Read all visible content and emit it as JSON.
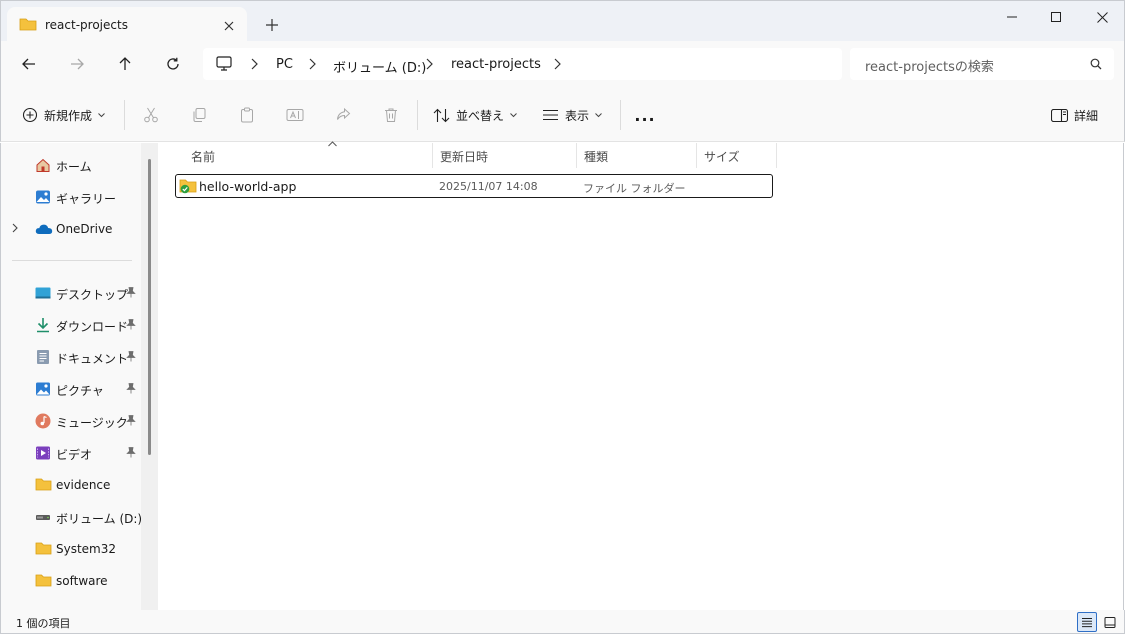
{
  "tab": {
    "title": "react-projects",
    "icon": "folder-icon"
  },
  "window_controls": [
    "minimize-icon",
    "maximize-icon",
    "close-icon"
  ],
  "address": {
    "root_icon": "pc-monitor-icon",
    "breadcrumbs": [
      "PC",
      "ボリューム (D:)",
      "react-projects"
    ]
  },
  "search": {
    "placeholder": "react-projectsの検索"
  },
  "toolbar": {
    "new_label": "新規作成",
    "sort_label": "並べ替え",
    "view_label": "表示",
    "more_label": "...",
    "details_label": "詳細"
  },
  "sidebar": {
    "items": [
      {
        "label": "ホーム",
        "icon": "home-icon"
      },
      {
        "label": "ギャラリー",
        "icon": "gallery-icon"
      },
      {
        "label": "OneDrive",
        "icon": "onedrive-cloud-icon"
      },
      {
        "label": "デスクトップ",
        "icon": "desktop-icon",
        "pinned": true
      },
      {
        "label": "ダウンロード",
        "icon": "download-icon",
        "pinned": true
      },
      {
        "label": "ドキュメント",
        "icon": "document-icon",
        "pinned": true
      },
      {
        "label": "ピクチャ",
        "icon": "pictures-icon",
        "pinned": true
      },
      {
        "label": "ミュージック",
        "icon": "music-icon",
        "pinned": true
      },
      {
        "label": "ビデオ",
        "icon": "video-icon",
        "pinned": true
      },
      {
        "label": "evidence",
        "icon": "folder-icon"
      },
      {
        "label": "ボリューム (D:)",
        "icon": "drive-icon"
      },
      {
        "label": "System32",
        "icon": "folder-icon"
      },
      {
        "label": "software",
        "icon": "folder-icon"
      }
    ]
  },
  "columns": [
    "名前",
    "更新日時",
    "種類",
    "サイズ"
  ],
  "files": [
    {
      "name": "hello-world-app",
      "modified": "2025/11/07 14:08",
      "type": "ファイル フォルダー",
      "size": "",
      "icon": "synced-folder-icon"
    }
  ],
  "status": {
    "item_count": "1 個の項目"
  },
  "colors": {
    "accent": "#2f6fc6",
    "folder": "#f4c13d",
    "sync_green": "#2e9e3e",
    "window_bg": "#f9f9f9",
    "tab_strip": "#eef1f6"
  }
}
